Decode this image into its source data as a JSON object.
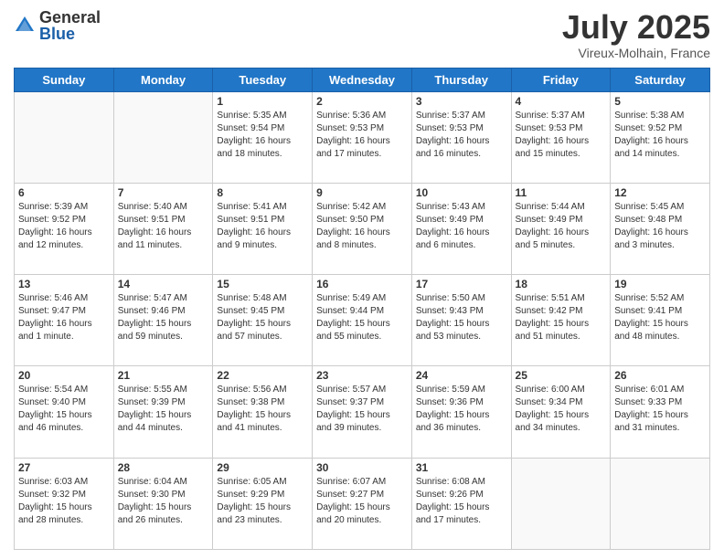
{
  "header": {
    "logo_general": "General",
    "logo_blue": "Blue",
    "month": "July 2025",
    "location": "Vireux-Molhain, France"
  },
  "days_of_week": [
    "Sunday",
    "Monday",
    "Tuesday",
    "Wednesday",
    "Thursday",
    "Friday",
    "Saturday"
  ],
  "weeks": [
    [
      {
        "day": "",
        "content": ""
      },
      {
        "day": "",
        "content": ""
      },
      {
        "day": "1",
        "content": "Sunrise: 5:35 AM\nSunset: 9:54 PM\nDaylight: 16 hours\nand 18 minutes."
      },
      {
        "day": "2",
        "content": "Sunrise: 5:36 AM\nSunset: 9:53 PM\nDaylight: 16 hours\nand 17 minutes."
      },
      {
        "day": "3",
        "content": "Sunrise: 5:37 AM\nSunset: 9:53 PM\nDaylight: 16 hours\nand 16 minutes."
      },
      {
        "day": "4",
        "content": "Sunrise: 5:37 AM\nSunset: 9:53 PM\nDaylight: 16 hours\nand 15 minutes."
      },
      {
        "day": "5",
        "content": "Sunrise: 5:38 AM\nSunset: 9:52 PM\nDaylight: 16 hours\nand 14 minutes."
      }
    ],
    [
      {
        "day": "6",
        "content": "Sunrise: 5:39 AM\nSunset: 9:52 PM\nDaylight: 16 hours\nand 12 minutes."
      },
      {
        "day": "7",
        "content": "Sunrise: 5:40 AM\nSunset: 9:51 PM\nDaylight: 16 hours\nand 11 minutes."
      },
      {
        "day": "8",
        "content": "Sunrise: 5:41 AM\nSunset: 9:51 PM\nDaylight: 16 hours\nand 9 minutes."
      },
      {
        "day": "9",
        "content": "Sunrise: 5:42 AM\nSunset: 9:50 PM\nDaylight: 16 hours\nand 8 minutes."
      },
      {
        "day": "10",
        "content": "Sunrise: 5:43 AM\nSunset: 9:49 PM\nDaylight: 16 hours\nand 6 minutes."
      },
      {
        "day": "11",
        "content": "Sunrise: 5:44 AM\nSunset: 9:49 PM\nDaylight: 16 hours\nand 5 minutes."
      },
      {
        "day": "12",
        "content": "Sunrise: 5:45 AM\nSunset: 9:48 PM\nDaylight: 16 hours\nand 3 minutes."
      }
    ],
    [
      {
        "day": "13",
        "content": "Sunrise: 5:46 AM\nSunset: 9:47 PM\nDaylight: 16 hours\nand 1 minute."
      },
      {
        "day": "14",
        "content": "Sunrise: 5:47 AM\nSunset: 9:46 PM\nDaylight: 15 hours\nand 59 minutes."
      },
      {
        "day": "15",
        "content": "Sunrise: 5:48 AM\nSunset: 9:45 PM\nDaylight: 15 hours\nand 57 minutes."
      },
      {
        "day": "16",
        "content": "Sunrise: 5:49 AM\nSunset: 9:44 PM\nDaylight: 15 hours\nand 55 minutes."
      },
      {
        "day": "17",
        "content": "Sunrise: 5:50 AM\nSunset: 9:43 PM\nDaylight: 15 hours\nand 53 minutes."
      },
      {
        "day": "18",
        "content": "Sunrise: 5:51 AM\nSunset: 9:42 PM\nDaylight: 15 hours\nand 51 minutes."
      },
      {
        "day": "19",
        "content": "Sunrise: 5:52 AM\nSunset: 9:41 PM\nDaylight: 15 hours\nand 48 minutes."
      }
    ],
    [
      {
        "day": "20",
        "content": "Sunrise: 5:54 AM\nSunset: 9:40 PM\nDaylight: 15 hours\nand 46 minutes."
      },
      {
        "day": "21",
        "content": "Sunrise: 5:55 AM\nSunset: 9:39 PM\nDaylight: 15 hours\nand 44 minutes."
      },
      {
        "day": "22",
        "content": "Sunrise: 5:56 AM\nSunset: 9:38 PM\nDaylight: 15 hours\nand 41 minutes."
      },
      {
        "day": "23",
        "content": "Sunrise: 5:57 AM\nSunset: 9:37 PM\nDaylight: 15 hours\nand 39 minutes."
      },
      {
        "day": "24",
        "content": "Sunrise: 5:59 AM\nSunset: 9:36 PM\nDaylight: 15 hours\nand 36 minutes."
      },
      {
        "day": "25",
        "content": "Sunrise: 6:00 AM\nSunset: 9:34 PM\nDaylight: 15 hours\nand 34 minutes."
      },
      {
        "day": "26",
        "content": "Sunrise: 6:01 AM\nSunset: 9:33 PM\nDaylight: 15 hours\nand 31 minutes."
      }
    ],
    [
      {
        "day": "27",
        "content": "Sunrise: 6:03 AM\nSunset: 9:32 PM\nDaylight: 15 hours\nand 28 minutes."
      },
      {
        "day": "28",
        "content": "Sunrise: 6:04 AM\nSunset: 9:30 PM\nDaylight: 15 hours\nand 26 minutes."
      },
      {
        "day": "29",
        "content": "Sunrise: 6:05 AM\nSunset: 9:29 PM\nDaylight: 15 hours\nand 23 minutes."
      },
      {
        "day": "30",
        "content": "Sunrise: 6:07 AM\nSunset: 9:27 PM\nDaylight: 15 hours\nand 20 minutes."
      },
      {
        "day": "31",
        "content": "Sunrise: 6:08 AM\nSunset: 9:26 PM\nDaylight: 15 hours\nand 17 minutes."
      },
      {
        "day": "",
        "content": ""
      },
      {
        "day": "",
        "content": ""
      }
    ]
  ]
}
